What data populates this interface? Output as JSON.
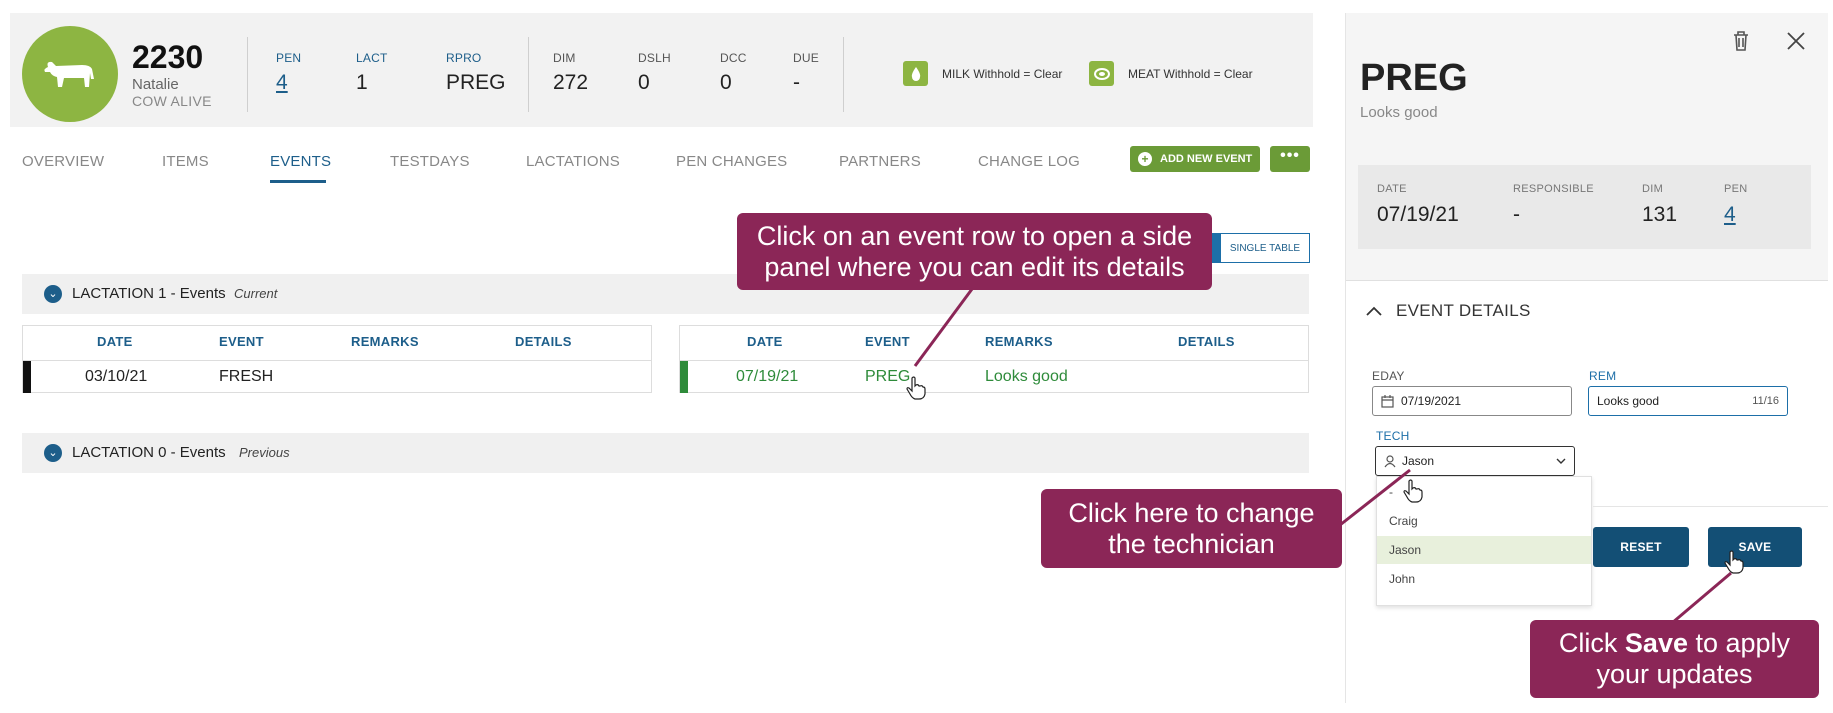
{
  "animal": {
    "id": "2230",
    "name": "Natalie",
    "status": "COW ALIVE",
    "stats": [
      {
        "label": "PEN",
        "value": "4"
      },
      {
        "label": "LACT",
        "value": "1"
      },
      {
        "label": "RPRO",
        "value": "PREG"
      },
      {
        "label": "DIM",
        "value": "272"
      },
      {
        "label": "DSLH",
        "value": "0"
      },
      {
        "label": "DCC",
        "value": "0"
      },
      {
        "label": "DUE",
        "value": "-"
      }
    ],
    "withholds": [
      {
        "label": "MILK Withhold = Clear",
        "icon": "milk-drop-icon"
      },
      {
        "label": "MEAT Withhold = Clear",
        "icon": "meat-icon"
      }
    ]
  },
  "tabs": [
    "OVERVIEW",
    "ITEMS",
    "EVENTS",
    "TESTDAYS",
    "LACTATIONS",
    "PEN CHANGES",
    "PARTNERS",
    "CHANGE LOG"
  ],
  "active_tab": "EVENTS",
  "toolbar": {
    "add_event_label": "ADD NEW EVENT",
    "more_label": "•••",
    "single_table_label": "SINGLE TABLE"
  },
  "lactations": [
    {
      "title": "LACTATION 1 - Events",
      "tag": "Current"
    },
    {
      "title": "LACTATION 0 - Events",
      "tag": "Previous"
    }
  ],
  "table_headers": [
    "DATE",
    "EVENT",
    "REMARKS",
    "DETAILS"
  ],
  "table_left": {
    "date": "03/10/21",
    "event": "FRESH",
    "remarks": "",
    "details": ""
  },
  "table_right": {
    "date": "07/19/21",
    "event": "PREG",
    "remarks": "Looks good",
    "details": ""
  },
  "side_panel": {
    "title": "PREG",
    "subtitle": "Looks good",
    "info": [
      {
        "label": "DATE",
        "value": "07/19/21"
      },
      {
        "label": "RESPONSIBLE",
        "value": "-"
      },
      {
        "label": "DIM",
        "value": "131"
      },
      {
        "label": "PEN",
        "value": "4"
      }
    ],
    "section_title": "EVENT DETAILS",
    "fields": {
      "eday_label": "EDAY",
      "eday_value": "07/19/2021",
      "rem_label": "REM",
      "rem_value": "Looks good",
      "rem_count": "11/16",
      "tech_label": "TECH",
      "tech_value": "Jason"
    },
    "tech_options": [
      "-",
      "Craig",
      "Jason",
      "John"
    ],
    "reset_label": "RESET",
    "save_label": "SAVE"
  },
  "callouts": {
    "row": "Click on an event row to open a side panel where you can edit its details",
    "tech": "Click here to change the technician",
    "save_pre": "Click ",
    "save_bold": "Save",
    "save_post": " to apply your updates"
  },
  "colors": {
    "brand_green": "#8db542",
    "primary_blue": "#134f75",
    "callout": "#8b2657",
    "event_green": "#2e8b3a"
  }
}
